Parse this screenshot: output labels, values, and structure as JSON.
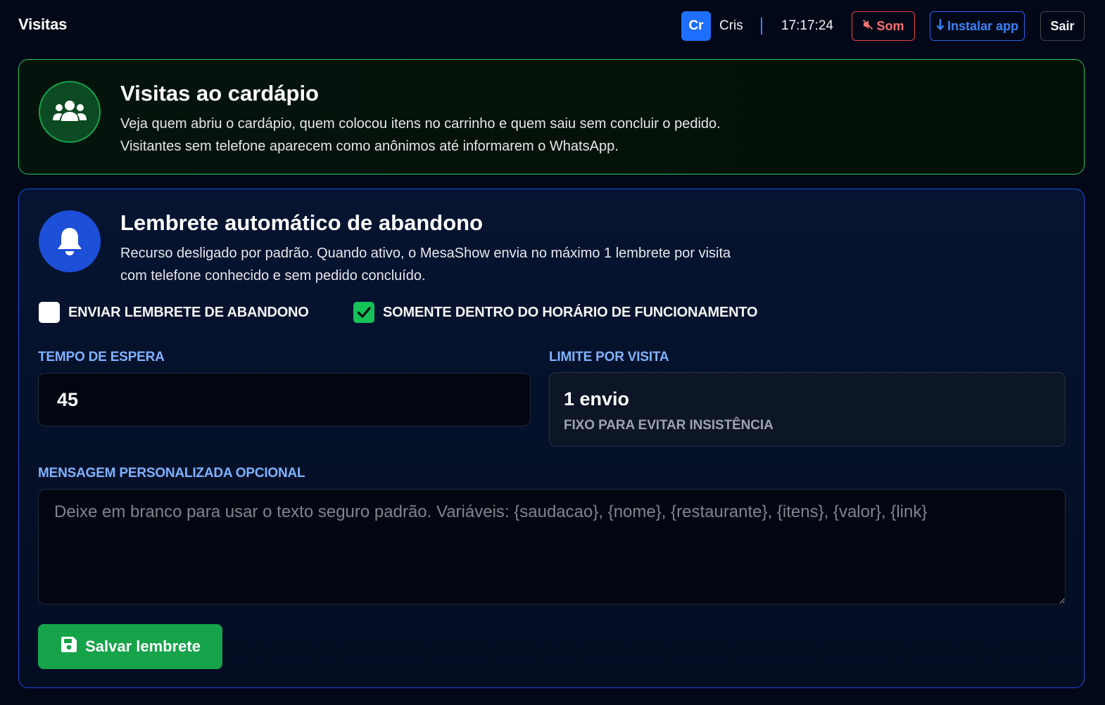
{
  "header": {
    "title": "Visitas",
    "user_initials": "Cr",
    "user_name": "Cris",
    "clock": "17:17:24",
    "sound_label": "Som",
    "install_label": "Instalar app",
    "logout_label": "Sair"
  },
  "visits_card": {
    "title": "Visitas ao cardápio",
    "desc_line1": "Veja quem abriu o cardápio, quem colocou itens no carrinho e quem saiu sem concluir o pedido.",
    "desc_line2": "Visitantes sem telefone aparecem como anônimos até informarem o WhatsApp."
  },
  "reminder_card": {
    "title": "Lembrete automático de abandono",
    "desc_line1": "Recurso desligado por padrão. Quando ativo, o MesaShow envia no máximo 1 lembrete por visita",
    "desc_line2": "com telefone conhecido e sem pedido concluído.",
    "send_reminder_label": "ENVIAR LEMBRETE DE ABANDONO",
    "send_reminder_checked": false,
    "business_hours_label": "SOMENTE DENTRO DO HORÁRIO DE FUNCIONAMENTO",
    "business_hours_checked": true,
    "wait_time_label": "TEMPO DE ESPERA",
    "wait_time_value": "45",
    "limit_label": "LIMITE POR VISITA",
    "limit_value": "1 envio",
    "limit_note": "FIXO PARA EVITAR INSISTÊNCIA",
    "message_label": "MENSAGEM PERSONALIZADA OPCIONAL",
    "message_placeholder": "Deixe em branco para usar o texto seguro padrão. Variáveis: {saudacao}, {nome}, {restaurante}, {itens}, {valor}, {link}",
    "save_label": "Salvar lembrete"
  },
  "colors": {
    "background": "#020818",
    "accent_green": "#16a34a",
    "accent_blue": "#1d4fd8",
    "label_blue": "#7fb2ff",
    "danger": "#ef4444"
  },
  "icons": [
    "users-icon",
    "bell-icon",
    "sound-off-icon",
    "download-icon",
    "floppy-disk-icon",
    "checkmark-icon"
  ]
}
